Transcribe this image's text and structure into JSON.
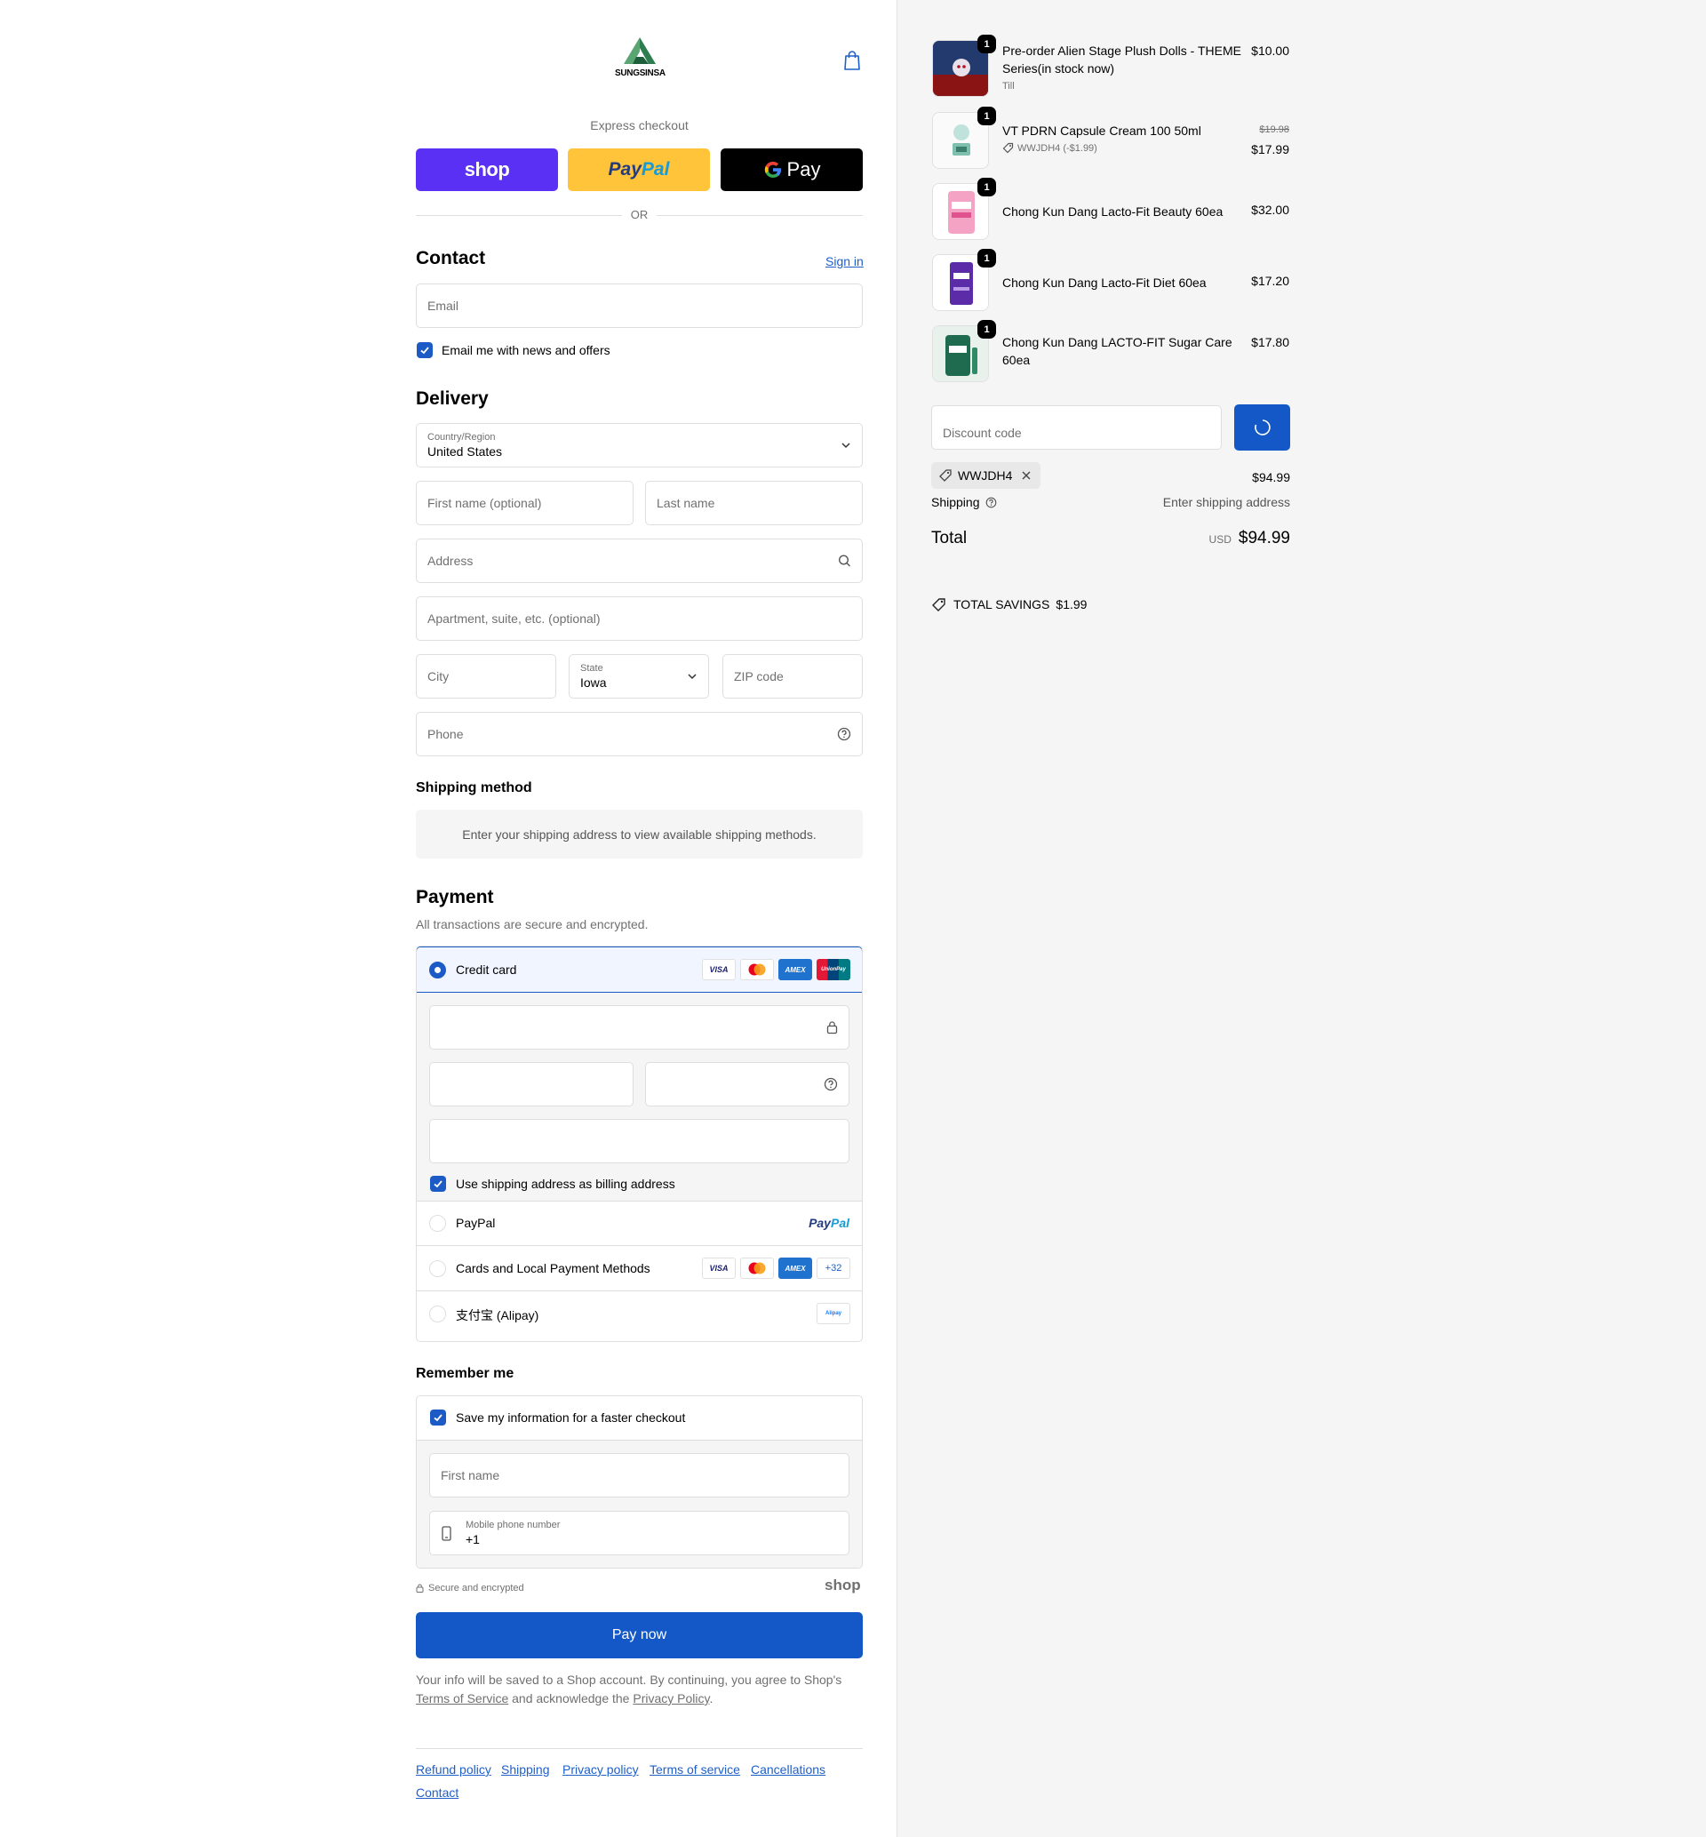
{
  "brand": {
    "name": "SUNGSINSA"
  },
  "express": {
    "label": "Express checkout",
    "shop_label": "shop",
    "paypal_label_1": "Pay",
    "paypal_label_2": "Pal",
    "gpay_label": "Pay",
    "or_label": "OR"
  },
  "contact": {
    "title": "Contact",
    "signin_label": "Sign in",
    "email_placeholder": "Email",
    "newsletter_label": "Email me with news and offers"
  },
  "delivery": {
    "title": "Delivery",
    "country_label": "Country/Region",
    "country_value": "United States",
    "first_name_placeholder": "First name (optional)",
    "last_name_placeholder": "Last name",
    "address_placeholder": "Address",
    "apartment_placeholder": "Apartment, suite, etc. (optional)",
    "city_placeholder": "City",
    "state_label": "State",
    "state_value": "Iowa",
    "zip_placeholder": "ZIP code",
    "phone_placeholder": "Phone"
  },
  "shipping_method": {
    "title": "Shipping method",
    "message": "Enter your shipping address to view available shipping methods."
  },
  "payment": {
    "title": "Payment",
    "subtitle": "All transactions are secure and encrypted.",
    "credit_card_label": "Credit card",
    "billing_label": "Use shipping address as billing address",
    "paypal_label": "PayPal",
    "paypal_logo_1": "Pay",
    "paypal_logo_2": "Pal",
    "cards_local_label": "Cards and Local Payment Methods",
    "cards_more": "+32",
    "alipay_label": "支付宝 (Alipay)",
    "alipay_logo": "Alipay",
    "card_brands": [
      "VISA",
      "AMEX",
      "UnionPay"
    ]
  },
  "remember": {
    "title": "Remember me",
    "save_label": "Save my information for a faster checkout",
    "first_name_placeholder": "First name",
    "mobile_label": "Mobile phone number",
    "mobile_value": "+1",
    "secure_label": "Secure and encrypted",
    "shop_logo": "shop"
  },
  "pay_now_label": "Pay now",
  "legal": {
    "text_1": "Your info will be saved to a Shop account. By continuing, you agree to Shop's",
    "tos_link": "Terms of Service",
    "text_2": "and acknowledge the",
    "privacy_link": "Privacy Policy",
    "text_3": "."
  },
  "footer_links": [
    "Refund policy",
    "Shipping",
    "Privacy policy",
    "Terms of service",
    "Cancellations",
    "Contact"
  ],
  "order": {
    "items": [
      {
        "name": "Pre-order Alien Stage Plush Dolls - THEME Series(in stock now)",
        "variant": "Till",
        "price": "$10.00",
        "qty": "1"
      },
      {
        "name": "VT PDRN Capsule Cream 100 50ml",
        "discount": "WWJDH4 (-$1.99)",
        "old_price": "$19.98",
        "price": "$17.99",
        "qty": "1"
      },
      {
        "name": "Chong Kun Dang Lacto-Fit Beauty 60ea",
        "price": "$32.00",
        "qty": "1"
      },
      {
        "name": "Chong Kun Dang Lacto-Fit Diet 60ea",
        "price": "$17.20",
        "qty": "1"
      },
      {
        "name": "Chong Kun Dang LACTO-FIT Sugar Care 60ea",
        "price": "$17.80",
        "qty": "1"
      }
    ],
    "discount_placeholder": "Discount code",
    "applied_code": "WWJDH4",
    "subtotal": "$94.99",
    "shipping_label": "Shipping",
    "shipping_value": "Enter shipping address",
    "total_label": "Total",
    "total_currency": "USD",
    "total_value": "$94.99",
    "savings_label": "TOTAL SAVINGS",
    "savings_value": "$1.99"
  },
  "colors": {
    "accent": "#1358c6",
    "shop_purple": "#5a31f4",
    "paypal_yellow": "#ffc439"
  }
}
